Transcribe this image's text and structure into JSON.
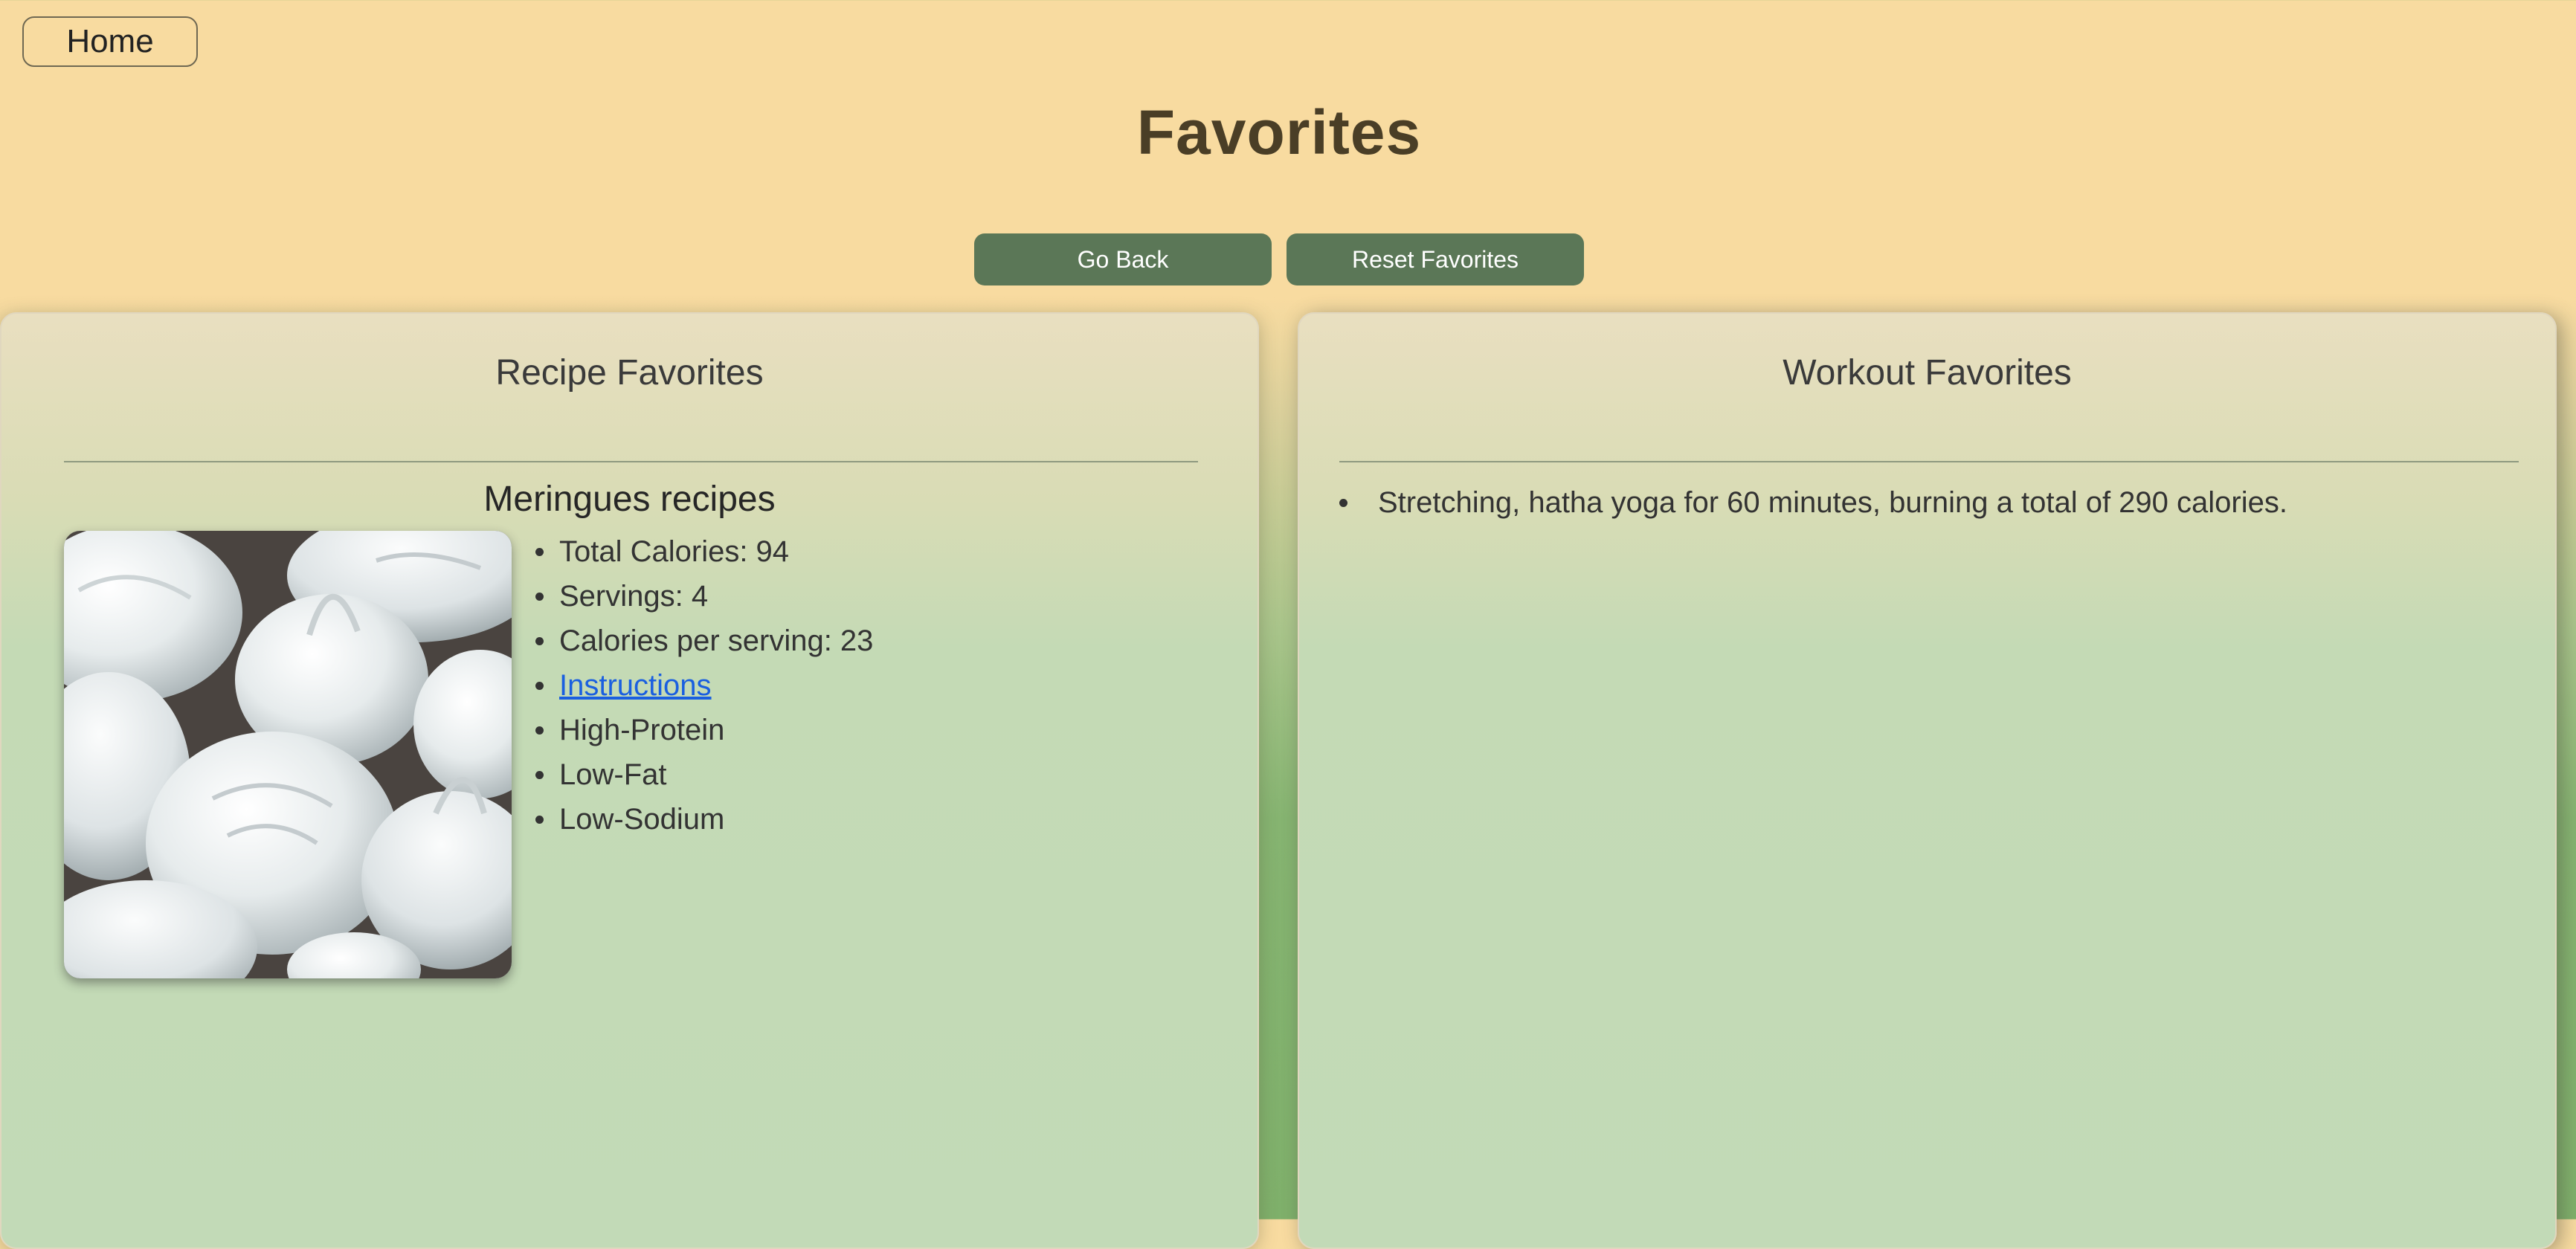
{
  "nav": {
    "home_label": "Home"
  },
  "page": {
    "title": "Favorites"
  },
  "actions": {
    "go_back_label": "Go Back",
    "reset_label": "Reset Favorites"
  },
  "recipes_panel": {
    "title": "Recipe Favorites",
    "recipe": {
      "name": "Meringues recipes",
      "total_calories": "Total Calories: 94",
      "servings": "Servings: 4",
      "calories_per_serving": "Calories per serving: 23",
      "instructions_label": "Instructions",
      "tags": [
        "High-Protein",
        "Low-Fat",
        "Low-Sodium"
      ]
    }
  },
  "workouts_panel": {
    "title": "Workout Favorites",
    "items": [
      "Stretching, hatha yoga for 60 minutes, burning a total of 290 calories."
    ]
  },
  "colors": {
    "background_top": "#f8dba0",
    "background_bottom": "#7fb06b",
    "button": "#5b7757",
    "link": "#1a5fe0",
    "title": "#4a3e26"
  }
}
